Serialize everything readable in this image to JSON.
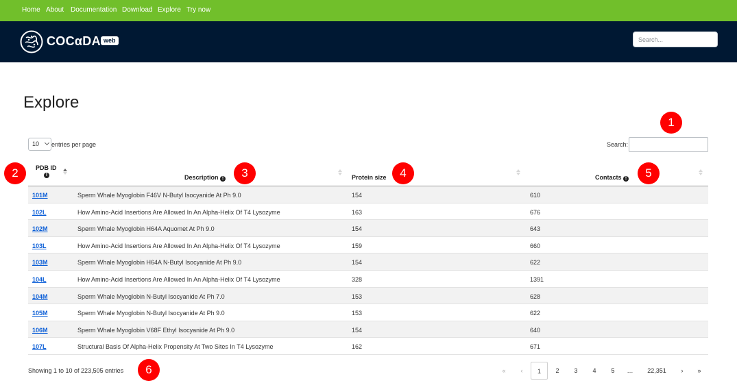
{
  "topnav": {
    "items": [
      "Home",
      "About",
      "Documentation",
      "Download",
      "Explore",
      "Try now"
    ]
  },
  "header": {
    "brand": "COCαDA",
    "badge": "web",
    "search_placeholder": "Search..."
  },
  "page": {
    "title": "Explore"
  },
  "table_controls": {
    "page_length_value": "10",
    "page_length_suffix": "entries per page",
    "filter_label": "Search:"
  },
  "table": {
    "columns": [
      {
        "label": "PDB ID"
      },
      {
        "label": "Description"
      },
      {
        "label": "Protein size"
      },
      {
        "label": "Contacts"
      }
    ],
    "rows": [
      {
        "id": "101M",
        "description": "Sperm Whale Myoglobin F46V N-Butyl Isocyanide At Ph 9.0",
        "size": "154",
        "contacts": "610"
      },
      {
        "id": "102L",
        "description": "How Amino-Acid Insertions Are Allowed In An Alpha-Helix Of T4 Lysozyme",
        "size": "163",
        "contacts": "676"
      },
      {
        "id": "102M",
        "description": "Sperm Whale Myoglobin H64A Aquomet At Ph 9.0",
        "size": "154",
        "contacts": "643"
      },
      {
        "id": "103L",
        "description": "How Amino-Acid Insertions Are Allowed In An Alpha-Helix Of T4 Lysozyme",
        "size": "159",
        "contacts": "660"
      },
      {
        "id": "103M",
        "description": "Sperm Whale Myoglobin H64A N-Butyl Isocyanide At Ph 9.0",
        "size": "154",
        "contacts": "622"
      },
      {
        "id": "104L",
        "description": "How Amino-Acid Insertions Are Allowed In An Alpha-Helix Of T4 Lysozyme",
        "size": "328",
        "contacts": "1391"
      },
      {
        "id": "104M",
        "description": "Sperm Whale Myoglobin N-Butyl Isocyanide At Ph 7.0",
        "size": "153",
        "contacts": "628"
      },
      {
        "id": "105M",
        "description": "Sperm Whale Myoglobin N-Butyl Isocyanide At Ph 9.0",
        "size": "153",
        "contacts": "622"
      },
      {
        "id": "106M",
        "description": "Sperm Whale Myoglobin V68F Ethyl Isocyanide At Ph 9.0",
        "size": "154",
        "contacts": "640"
      },
      {
        "id": "107L",
        "description": "Structural Basis Of Alpha-Helix Propensity At Two Sites In T4 Lysozyme",
        "size": "162",
        "contacts": "671"
      }
    ]
  },
  "footer": {
    "info": "Showing 1 to 10 of 223,505 entries",
    "pagination": [
      "«",
      "‹",
      "1",
      "2",
      "3",
      "4",
      "5",
      "…",
      "22,351",
      "›",
      "»"
    ],
    "active_page": "1"
  },
  "annotations": [
    "1",
    "2",
    "3",
    "4",
    "5",
    "6"
  ],
  "colors": {
    "topnav_bg": "#71bf2b",
    "header_bg": "#001833",
    "link": "#0b5ed7",
    "marker": "#ff0000"
  }
}
